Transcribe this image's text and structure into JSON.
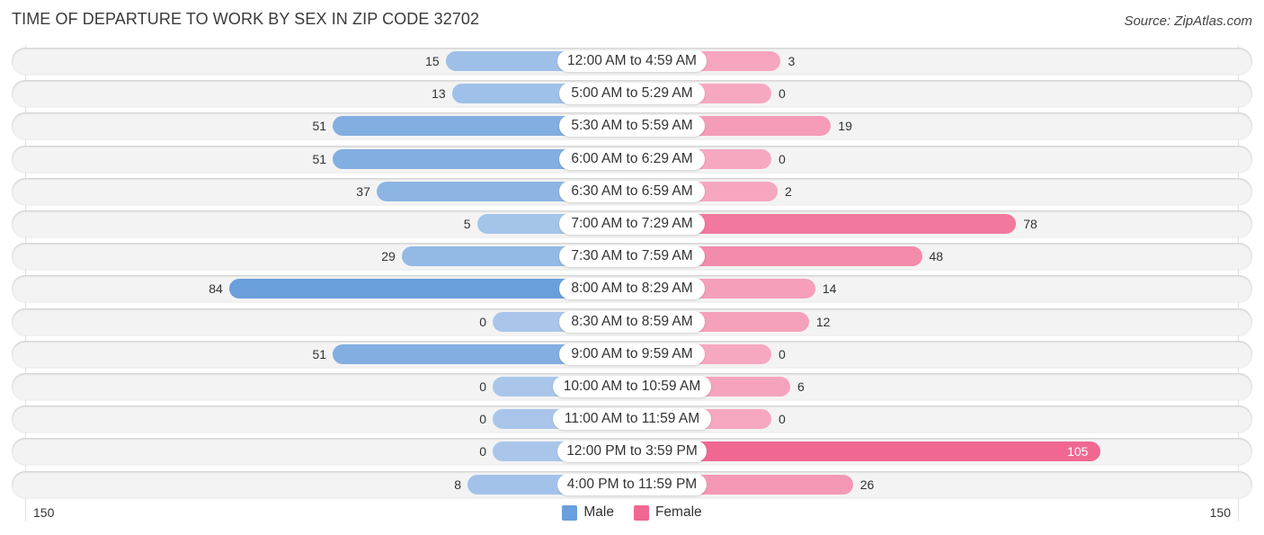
{
  "title": "TIME OF DEPARTURE TO WORK BY SEX IN ZIP CODE 32702",
  "source": "Source: ZipAtlas.com",
  "colors": {
    "male": "#6a9fdb",
    "male_light": "#a9c6ea",
    "female": "#f06892",
    "female_light": "#f6a8c0",
    "row_bg": "#f3f3f3"
  },
  "chart_data": {
    "type": "bar",
    "orientation": "horizontal-diverging",
    "title": "TIME OF DEPARTURE TO WORK BY SEX IN ZIP CODE 32702",
    "categories": [
      "12:00 AM to 4:59 AM",
      "5:00 AM to 5:29 AM",
      "5:30 AM to 5:59 AM",
      "6:00 AM to 6:29 AM",
      "6:30 AM to 6:59 AM",
      "7:00 AM to 7:29 AM",
      "7:30 AM to 7:59 AM",
      "8:00 AM to 8:29 AM",
      "8:30 AM to 8:59 AM",
      "9:00 AM to 9:59 AM",
      "10:00 AM to 10:59 AM",
      "11:00 AM to 11:59 AM",
      "12:00 PM to 3:59 PM",
      "4:00 PM to 11:59 PM"
    ],
    "series": [
      {
        "name": "Male",
        "side": "left",
        "values": [
          15,
          13,
          51,
          51,
          37,
          5,
          29,
          84,
          0,
          51,
          0,
          0,
          0,
          8
        ]
      },
      {
        "name": "Female",
        "side": "right",
        "values": [
          3,
          0,
          19,
          0,
          2,
          78,
          48,
          14,
          12,
          0,
          6,
          0,
          105,
          26
        ]
      }
    ],
    "xlim": [
      -150,
      150
    ],
    "axis_tick_labels": {
      "left": "150",
      "right": "150"
    },
    "legend": [
      "Male",
      "Female"
    ],
    "legend_position": "bottom-center",
    "grid": false
  }
}
